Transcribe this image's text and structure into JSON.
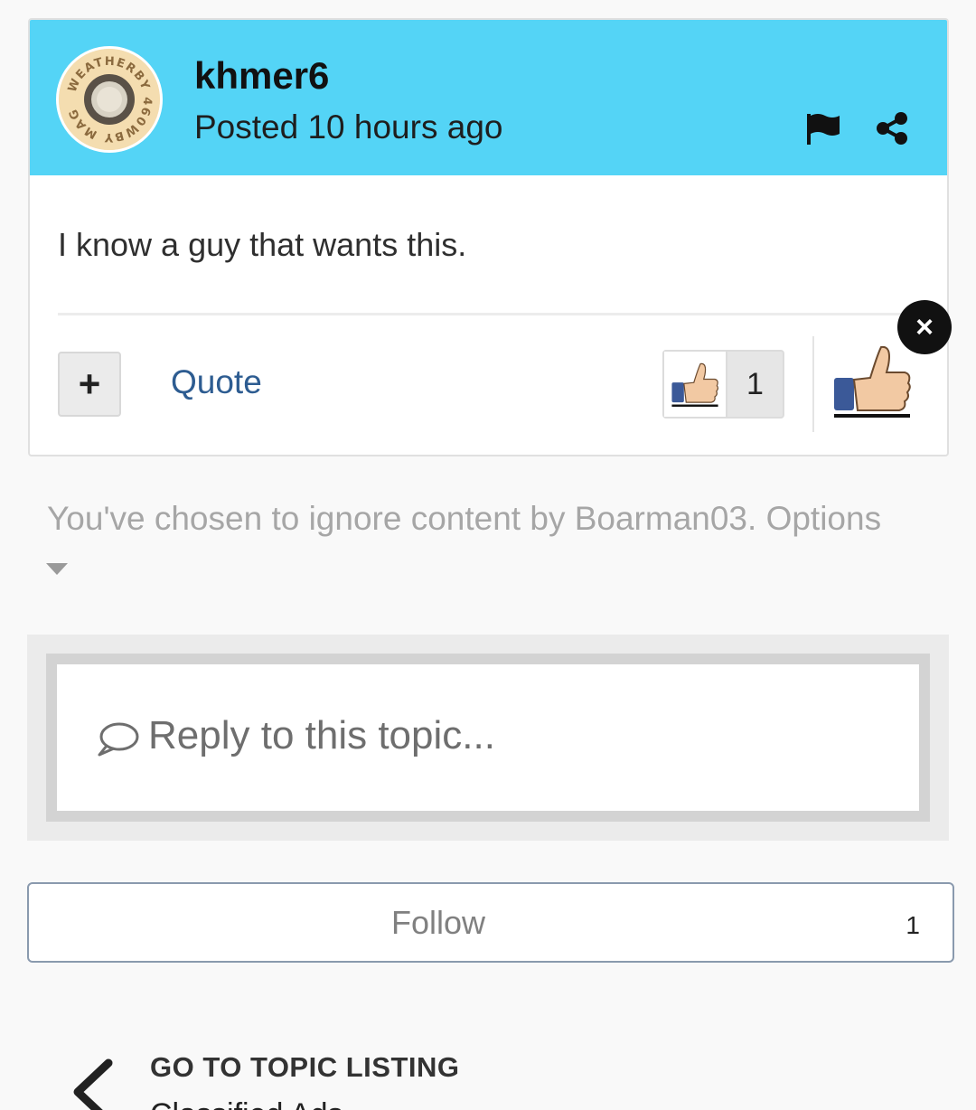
{
  "post": {
    "author": "khmer6",
    "meta": "Posted 10 hours ago",
    "avatar": {
      "ring_text": "WEATHERBY 460WBY MAG",
      "colors": {
        "bg": "#f4ddb0",
        "ring": "#8b6a3e"
      }
    },
    "body": "I know a guy that wants this.",
    "actions": {
      "plus_label": "+",
      "quote_label": "Quote",
      "reaction_count": "1"
    },
    "close_label": "×"
  },
  "ignore_notice": {
    "text": "You've chosen to ignore content by Boarman03. Options"
  },
  "reply": {
    "placeholder": "Reply to this topic..."
  },
  "follow": {
    "label": "Follow",
    "count": "1"
  },
  "topic_nav": {
    "label": "GO TO TOPIC LISTING",
    "name": "Classified Ads"
  },
  "colors": {
    "header_bg": "#54d4f6",
    "link": "#2d5c91",
    "muted_text": "#a6a6a6"
  },
  "icons": [
    "flag-icon",
    "share-icon",
    "close-icon",
    "thumbs-up-icon",
    "speech-bubble-icon",
    "chevron-left-icon",
    "caret-down-icon"
  ]
}
